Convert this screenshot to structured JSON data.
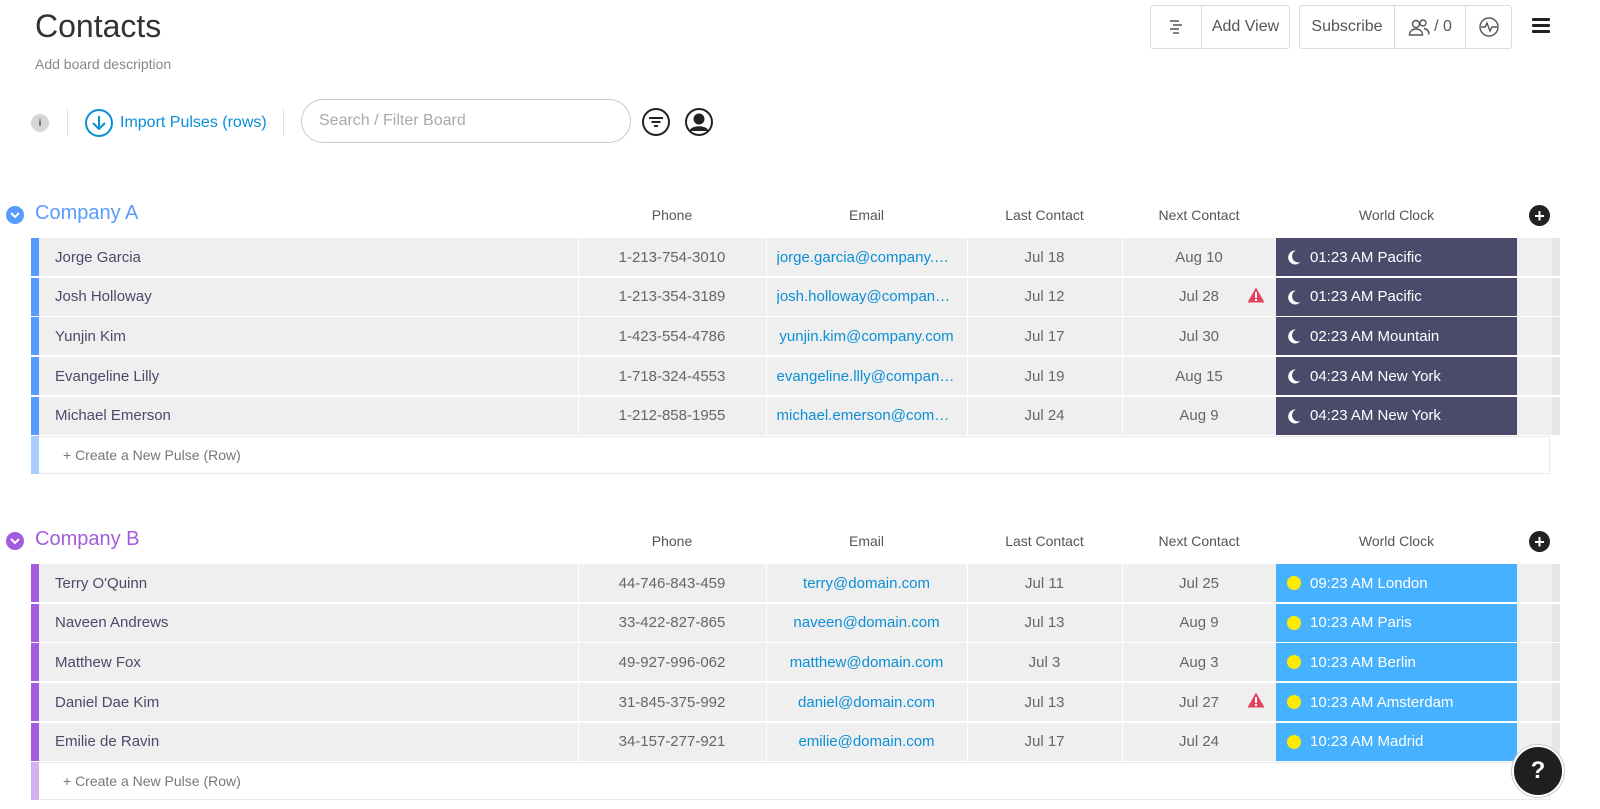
{
  "board": {
    "title": "Contacts",
    "description": "Add board description"
  },
  "header": {
    "add_view_label": "Add View",
    "subscribe_label": "Subscribe",
    "subscribers_count": "/ 0"
  },
  "toolbar": {
    "info_label": "i",
    "import_label": "Import Pulses (rows)",
    "search_placeholder": "Search / Filter Board"
  },
  "columns": {
    "phone": "Phone",
    "email": "Email",
    "last_contact": "Last Contact",
    "next_contact": "Next Contact",
    "world_clock": "World Clock"
  },
  "create_row_label": "+ Create a New Pulse (Row)",
  "colors": {
    "group_a": "#579bfc",
    "group_b": "#a25ddc",
    "clock_night": "#4b4a6b",
    "clock_day": "#46b1ff",
    "link": "#0b8fd6",
    "warning": "#e2445c"
  },
  "groups": [
    {
      "name": "Company A",
      "rows": [
        {
          "name": "Jorge Garcia",
          "phone": "1-213-754-3010",
          "email": "jorge.garcia@company.com",
          "last": "Jul 18",
          "next": "Aug 10",
          "warning": false,
          "clock": "01:23 AM Pacific",
          "clock_icon": "moon-icon"
        },
        {
          "name": "Josh Holloway",
          "phone": "1-213-354-3189",
          "email": "josh.holloway@company.c...",
          "last": "Jul 12",
          "next": "Jul 28",
          "warning": true,
          "clock": "01:23 AM Pacific",
          "clock_icon": "moon-icon"
        },
        {
          "name": "Yunjin Kim",
          "phone": "1-423-554-4786",
          "email": "yunjin.kim@company.com",
          "last": "Jul 17",
          "next": "Jul 30",
          "warning": false,
          "clock": "02:23 AM Mountain",
          "clock_icon": "moon-icon"
        },
        {
          "name": "Evangeline Lilly",
          "phone": "1-718-324-4553",
          "email": "evangeline.llly@company.c...",
          "last": "Jul 19",
          "next": "Aug 15",
          "warning": false,
          "clock": "04:23 AM New York",
          "clock_icon": "moon-icon"
        },
        {
          "name": "Michael Emerson",
          "phone": "1-212-858-1955",
          "email": "michael.emerson@compa...",
          "last": "Jul 24",
          "next": "Aug 9",
          "warning": false,
          "clock": "04:23 AM New York",
          "clock_icon": "moon-icon"
        }
      ]
    },
    {
      "name": "Company B",
      "rows": [
        {
          "name": "Terry O'Quinn",
          "phone": "44-746-843-459",
          "email": "terry@domain.com",
          "last": "Jul 11",
          "next": "Jul 25",
          "warning": false,
          "clock": "09:23 AM London",
          "clock_icon": "sun-icon"
        },
        {
          "name": "Naveen Andrews",
          "phone": "33-422-827-865",
          "email": "naveen@domain.com",
          "last": "Jul 13",
          "next": "Aug 9",
          "warning": false,
          "clock": "10:23 AM Paris",
          "clock_icon": "sun-icon"
        },
        {
          "name": "Matthew Fox",
          "phone": "49-927-996-062",
          "email": "matthew@domain.com",
          "last": "Jul 3",
          "next": "Aug 3",
          "warning": false,
          "clock": "10:23 AM Berlin",
          "clock_icon": "sun-icon"
        },
        {
          "name": "Daniel Dae Kim",
          "phone": "31-845-375-992",
          "email": "daniel@domain.com",
          "last": "Jul 13",
          "next": "Jul 27",
          "warning": true,
          "clock": "10:23 AM Amsterdam",
          "clock_icon": "sun-icon"
        },
        {
          "name": "Emilie de Ravin",
          "phone": "34-157-277-921",
          "email": "emilie@domain.com",
          "last": "Jul 17",
          "next": "Jul 24",
          "warning": false,
          "clock": "10:23 AM Madrid",
          "clock_icon": "sun-icon"
        }
      ]
    }
  ],
  "help_label": "?"
}
